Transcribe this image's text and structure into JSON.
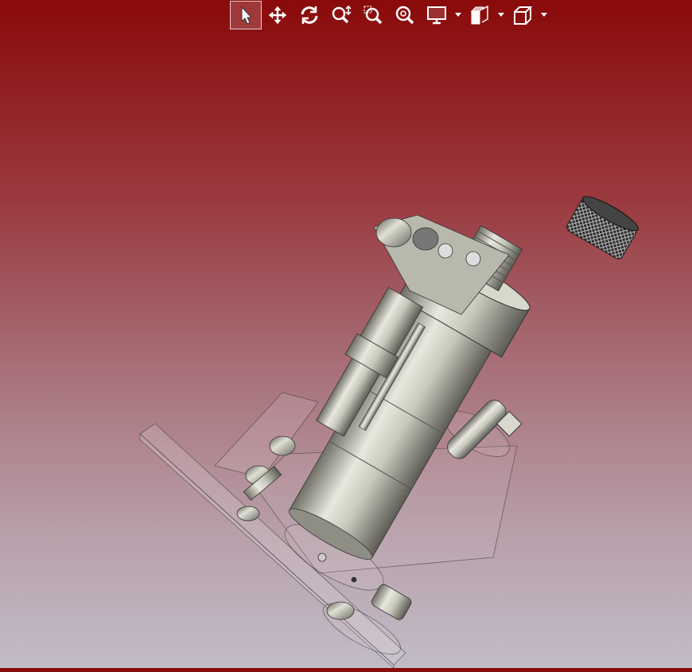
{
  "toolbar": {
    "tools": [
      {
        "name": "select-tool-button",
        "icon": "cursor-arrow-icon",
        "active": true
      },
      {
        "name": "pan-tool-button",
        "icon": "move-arrows-icon",
        "active": false
      },
      {
        "name": "rotate-tool-button",
        "icon": "rotate-icon",
        "active": false
      },
      {
        "name": "zoom-tool-button",
        "icon": "zoom-vertical-icon",
        "active": false
      },
      {
        "name": "zoom-window-button",
        "icon": "zoom-window-icon",
        "active": false
      },
      {
        "name": "zoom-fit-button",
        "icon": "zoom-fit-icon",
        "active": false
      },
      {
        "name": "display-mode-button",
        "icon": "monitor-icon",
        "has_dropdown": true
      },
      {
        "name": "section-view-button",
        "icon": "section-box-icon",
        "has_dropdown": true
      },
      {
        "name": "standard-views-button",
        "icon": "cube-view-icon",
        "has_dropdown": true
      }
    ],
    "icon_color": "#ffffff"
  },
  "viewport": {
    "background_top": "#8a0a0a",
    "background_bottom": "#c2bcc8",
    "model": "cad-assembly-metal-valve",
    "metal_color": "#c9c9bd",
    "ghost_color": "#e8dde3"
  }
}
